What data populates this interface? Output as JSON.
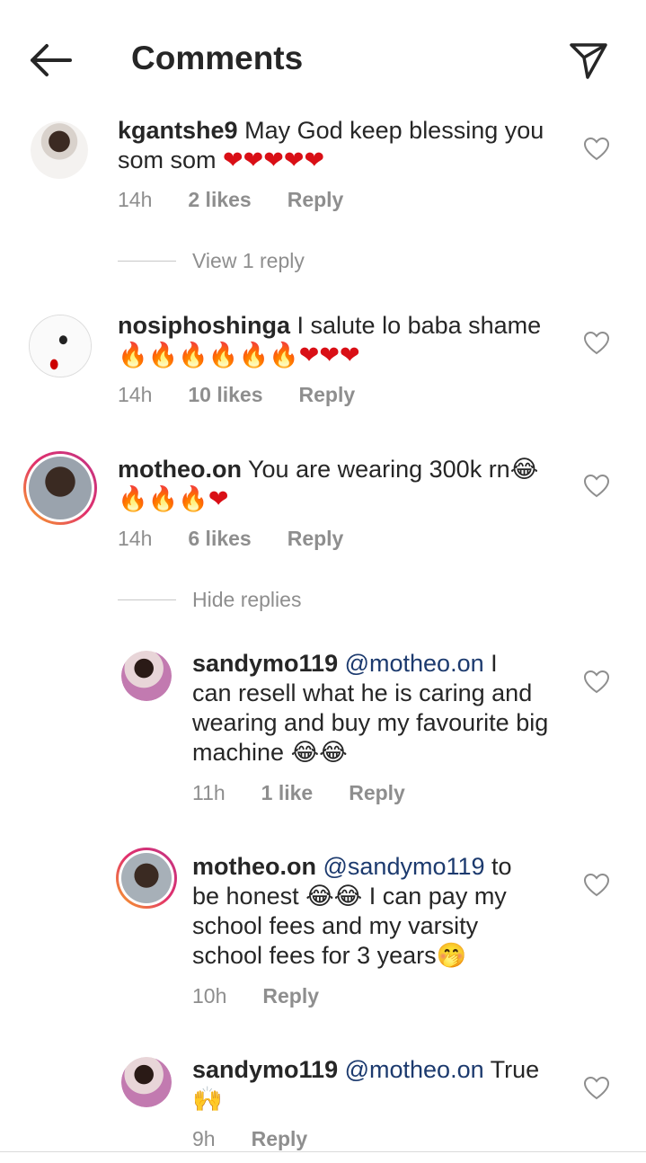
{
  "header": {
    "title": "Comments"
  },
  "comments": [
    {
      "user": "kgantshe9",
      "text": "May God keep blessing you som som",
      "emoji": "❤❤❤❤❤",
      "time": "14h",
      "likes": "2 likes",
      "reply": "Reply",
      "thread": "View 1 reply"
    },
    {
      "user": "nosiphoshinga",
      "text": "I salute lo baba shame",
      "emoji_fire": "🔥🔥🔥🔥🔥🔥",
      "emoji_heart": "❤❤❤",
      "time": "14h",
      "likes": "10 likes",
      "reply": "Reply"
    },
    {
      "user": "motheo.on",
      "text": "You are wearing 300k rn",
      "emoji_laugh": "😂",
      "emoji_fire": "🔥🔥🔥",
      "emoji_heart": "❤",
      "time": "14h",
      "likes": "6 likes",
      "reply": "Reply",
      "thread": "Hide replies"
    }
  ],
  "replies": [
    {
      "user": "sandymo119",
      "mention": "@motheo.on",
      "text1": "I",
      "text2": "can resell what he is caring and",
      "text3": "wearing and buy my favourite big",
      "text4": "machine",
      "emoji": "😂😂",
      "time": "11h",
      "likes": "1 like",
      "reply": "Reply"
    },
    {
      "user": "motheo.on",
      "mention": "@sandymo119",
      "text1": "to",
      "text2a": "be honest",
      "emoji_a": "😂😂",
      "text2b": "I can pay my",
      "text3": "school fees and my varsity",
      "text4": "school fees for 3 years",
      "emoji_b": "🤭",
      "time": "10h",
      "reply": "Reply"
    },
    {
      "user": "sandymo119",
      "mention": "@motheo.on",
      "text1": "True",
      "emoji": "🙌",
      "time": "9h",
      "reply": "Reply"
    }
  ],
  "colors": {
    "text": "#262626",
    "muted": "#8e8e8e",
    "mention": "#1c3a6e",
    "heart": "#d90f16"
  }
}
